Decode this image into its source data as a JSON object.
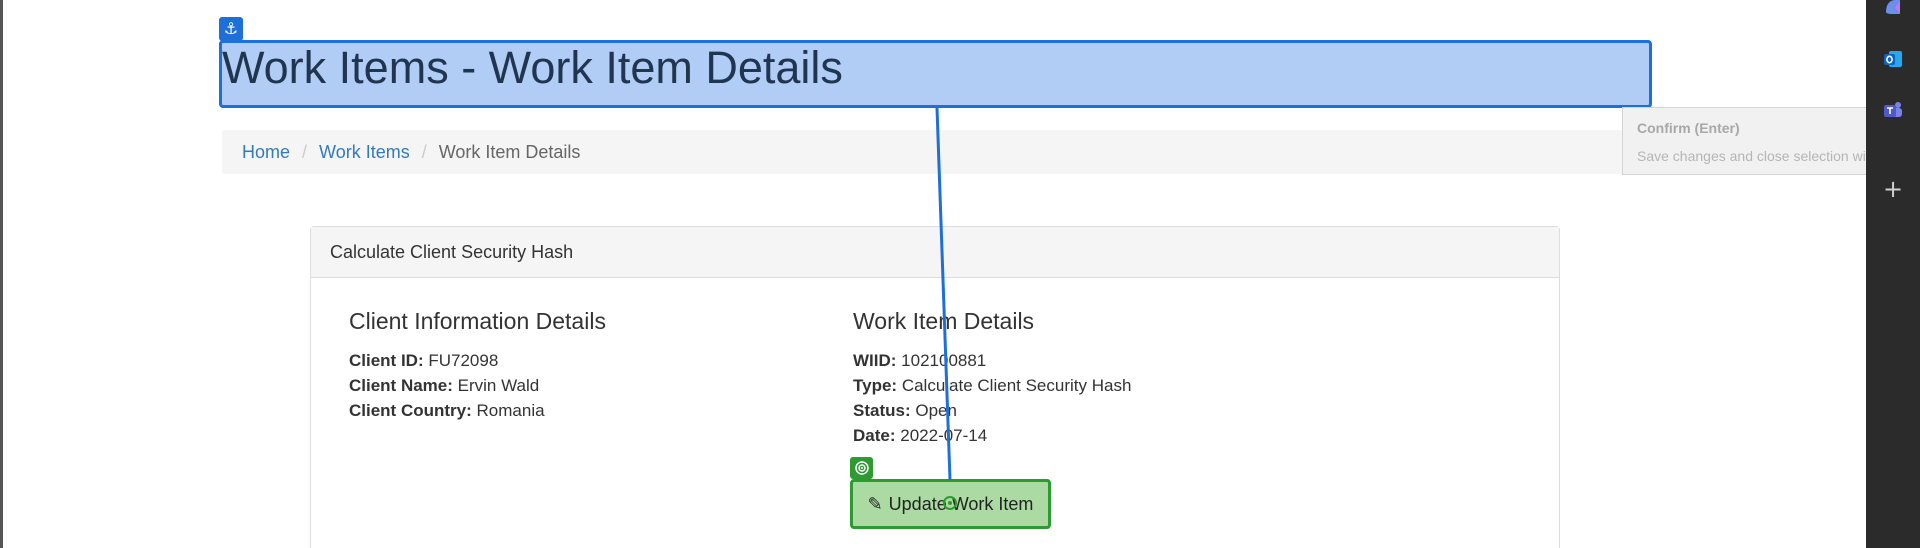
{
  "page": {
    "title": "Work Items - Work Item Details"
  },
  "breadcrumb": {
    "items": [
      {
        "label": "Home"
      },
      {
        "label": "Work Items"
      },
      {
        "label": "Work Item Details"
      }
    ],
    "separator": "/"
  },
  "panel": {
    "heading": "Calculate Client Security Hash",
    "client_section": {
      "heading": "Client Information Details",
      "fields": [
        {
          "label": "Client ID:",
          "value": "FU72098"
        },
        {
          "label": "Client Name:",
          "value": "Ervin Wald"
        },
        {
          "label": "Client Country:",
          "value": "Romania"
        }
      ]
    },
    "work_item_section": {
      "heading": "Work Item Details",
      "fields": [
        {
          "label": "WIID:",
          "value": "102100881"
        },
        {
          "label": "Type:",
          "value": "Calculate Client Security Hash"
        },
        {
          "label": "Status:",
          "value": "Open"
        },
        {
          "label": "Date:",
          "value": "2022-07-14"
        }
      ]
    },
    "update_button": {
      "label": "Update Work Item",
      "icon": "pencil-icon"
    }
  },
  "tooltip": {
    "title": "Confirm (Enter)",
    "description": "Save changes and close selection wizard."
  },
  "sidebar": {
    "items": [
      {
        "icon": "copilot-icon"
      },
      {
        "icon": "outlook-icon"
      },
      {
        "icon": "teams-icon"
      },
      {
        "icon": "plus-icon"
      }
    ]
  },
  "colors": {
    "selection_blue": "#1e6fd9",
    "selection_green": "#2e9a32",
    "link": "#337ab7",
    "sidebar_bg": "#2b2b2b"
  }
}
